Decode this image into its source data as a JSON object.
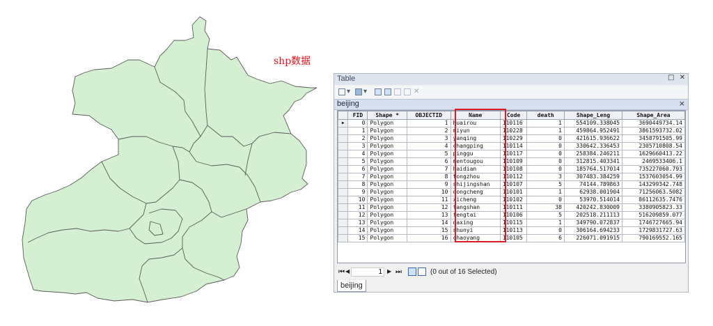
{
  "annotation": "shp数据",
  "colors": {
    "map_fill": "#d4efd1",
    "map_stroke": "#5a5a5a",
    "highlight": "#e01a22",
    "annotation": "#e8141c"
  },
  "window": {
    "title": "Table",
    "controls": [
      "pin-icon",
      "close-icon"
    ],
    "toolbar_icons": [
      "table-options-icon",
      "related-tables-icon",
      "select-by-attributes-icon",
      "switch-selection-icon",
      "clear-selection-icon",
      "zoom-to-selected-icon",
      "delete-selected-icon"
    ],
    "tab": "beijing",
    "bottom_tab": "beijing",
    "status": {
      "page": "1",
      "selection": "(0 out of 16 Selected)"
    }
  },
  "table": {
    "columns": [
      "FID",
      "Shape *",
      "OBJECTID",
      "Name",
      "Code",
      "death",
      "Shape_Leng",
      "Shape_Area"
    ],
    "rows": [
      [
        "0",
        "Polygon",
        "1",
        "huairou",
        "110116",
        "1",
        "554109.338045",
        "3690449734.14"
      ],
      [
        "1",
        "Polygon",
        "2",
        "miyun",
        "110228",
        "1",
        "459864.952491",
        "3861593732.02"
      ],
      [
        "2",
        "Polygon",
        "3",
        "yanqing",
        "110229",
        "0",
        "421615.936622",
        "3458791505.99"
      ],
      [
        "3",
        "Polygon",
        "4",
        "changping",
        "110114",
        "0",
        "330642.336453",
        "2305710808.54"
      ],
      [
        "4",
        "Polygon",
        "5",
        "pinggu",
        "110117",
        "0",
        "258384.246211",
        "1629660413.22"
      ],
      [
        "5",
        "Polygon",
        "6",
        "mentougou",
        "110109",
        "0",
        "312815.403341",
        "2469533406.1"
      ],
      [
        "6",
        "Polygon",
        "7",
        "haidian",
        "110108",
        "0",
        "185764.517014",
        "735227060.793"
      ],
      [
        "7",
        "Polygon",
        "8",
        "tongzhou",
        "110112",
        "3",
        "307483.384259",
        "1537603054.99"
      ],
      [
        "8",
        "Polygon",
        "9",
        "shijingshan",
        "110107",
        "5",
        "74144.789863",
        "143299342.748"
      ],
      [
        "9",
        "Polygon",
        "10",
        "dongcheng",
        "110101",
        "1",
        "62938.001904",
        "71256063.5082"
      ],
      [
        "10",
        "Polygon",
        "11",
        "xicheng",
        "110102",
        "0",
        "53970.514014",
        "86112635.7476"
      ],
      [
        "11",
        "Polygon",
        "12",
        "fangshan",
        "110111",
        "38",
        "420242.830009",
        "3380905823.33"
      ],
      [
        "12",
        "Polygon",
        "13",
        "fengtai",
        "110106",
        "5",
        "202518.211113",
        "516209859.077"
      ],
      [
        "13",
        "Polygon",
        "14",
        "daxing",
        "110115",
        "1",
        "349790.072837",
        "1746727665.94"
      ],
      [
        "14",
        "Polygon",
        "15",
        "shunyi",
        "110113",
        "0",
        "306164.694233",
        "1729831727.63"
      ],
      [
        "15",
        "Polygon",
        "16",
        "chaoyang",
        "110105",
        "6",
        "226071.091915",
        "790169552.165"
      ]
    ]
  }
}
